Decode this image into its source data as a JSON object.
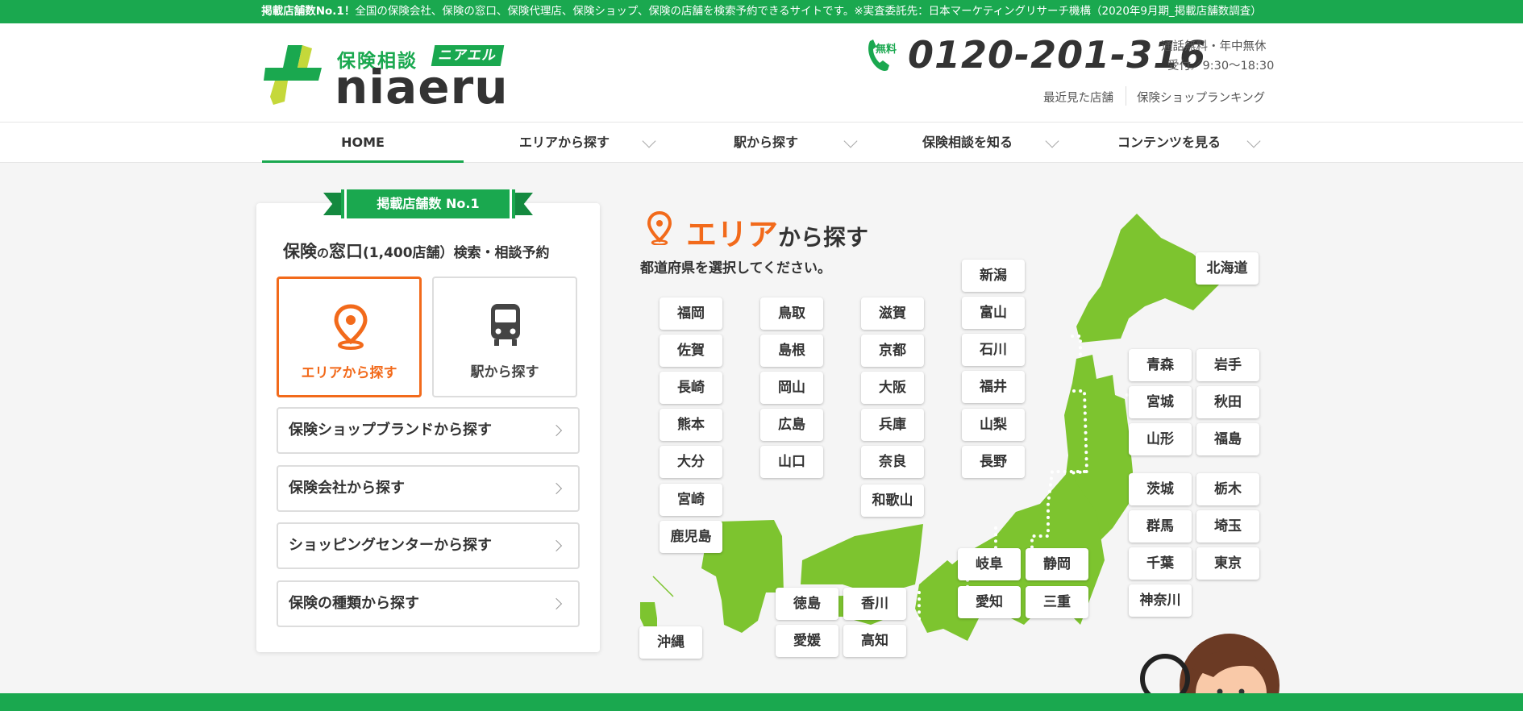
{
  "topbar": {
    "lead": "掲載店舗数No.1！",
    "text": "全国の保険会社、保険の窓口、保険代理店、保険ショップ、保険の店舗を検索予約できるサイトです。※実査委託先：日本マーケティングリサーチ機構（2020年9月期_掲載店舗数調査）"
  },
  "header": {
    "logo_sub": "保険相談",
    "logo_badge": "ニアエル",
    "logo_main": "niaeru",
    "phone_badge": "無料",
    "phone_number": "0120-201-316",
    "phone_note1": "通話無料・年中無休",
    "phone_note2": "受付／9:30〜18:30",
    "link_recent": "最近見た店舗",
    "link_ranking": "保険ショップランキング"
  },
  "nav": {
    "items": [
      {
        "label": "HOME"
      },
      {
        "label": "エリアから探す"
      },
      {
        "label": "駅から探す"
      },
      {
        "label": "保険相談を知る"
      },
      {
        "label": "コンテンツを見る"
      }
    ]
  },
  "panel": {
    "ribbon": "掲載店舗数 No.1",
    "title_a": "保険",
    "title_b": "の",
    "title_c": "窓口",
    "title_count": "(1,400店舗）",
    "title_d": "検索・相談予約",
    "tile_area": "エリアから探す",
    "tile_station": "駅から探す",
    "menu": [
      {
        "label": "保険ショップブランドから探す"
      },
      {
        "label": "保険会社から探す"
      },
      {
        "label": "ショッピングセンターから探す"
      },
      {
        "label": "保険の種類から探す"
      }
    ]
  },
  "map": {
    "title_main": "エリア",
    "title_rest": "から探す",
    "subtitle": "都道府県を選択してください。",
    "land_color": "#7dc42f",
    "prefectures": {
      "hokkaido": "北海道",
      "aomori": "青森",
      "iwate": "岩手",
      "miyagi": "宮城",
      "akita": "秋田",
      "yamagata": "山形",
      "fukushima": "福島",
      "ibaraki": "茨城",
      "tochigi": "栃木",
      "gunma": "群馬",
      "saitama": "埼玉",
      "chiba": "千葉",
      "tokyo": "東京",
      "kanagawa": "神奈川",
      "niigata": "新潟",
      "toyama": "富山",
      "ishikawa": "石川",
      "fukui": "福井",
      "yamanashi": "山梨",
      "nagano": "長野",
      "gifu": "岐阜",
      "shizuoka": "静岡",
      "aichi": "愛知",
      "mie": "三重",
      "shiga": "滋賀",
      "kyoto": "京都",
      "osaka": "大阪",
      "hyogo": "兵庫",
      "nara": "奈良",
      "wakayama": "和歌山",
      "tottori": "鳥取",
      "shimane": "島根",
      "okayama": "岡山",
      "hiroshima": "広島",
      "yamaguchi": "山口",
      "tokushima": "徳島",
      "kagawa": "香川",
      "ehime": "愛媛",
      "kochi": "高知",
      "fukuoka": "福岡",
      "saga": "佐賀",
      "nagasaki": "長崎",
      "kumamoto": "熊本",
      "oita": "大分",
      "miyazaki": "宮崎",
      "kagoshima": "鹿児島",
      "okinawa": "沖縄"
    }
  },
  "colors": {
    "brand_green": "#1aa84f",
    "accent_orange": "#f26a1b"
  }
}
